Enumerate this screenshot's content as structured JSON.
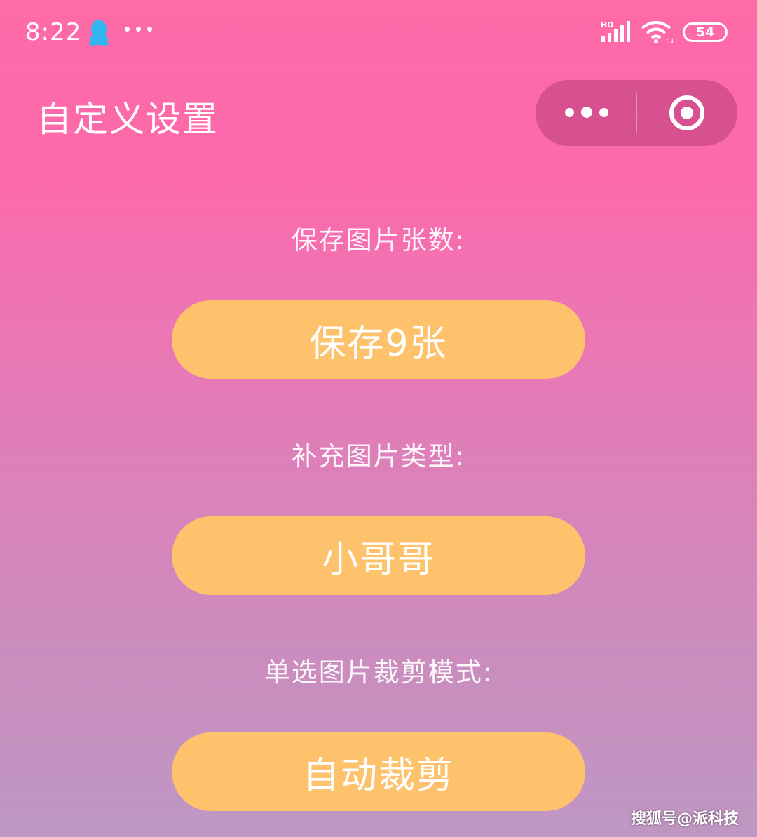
{
  "status_bar": {
    "time": "8:22",
    "battery": "54",
    "qq_icon": "qq-penguin-icon",
    "signal_label": "HD"
  },
  "nav": {
    "title": "自定义设置",
    "more_icon": "more-dots-icon",
    "close_icon": "target-close-icon",
    "capsule_color": "#b8407f"
  },
  "settings": [
    {
      "label": "保存图片张数:",
      "value": "保存9张"
    },
    {
      "label": "补充图片类型:",
      "value": "小哥哥"
    },
    {
      "label": "单选图片裁剪模式:",
      "value": "自动裁剪"
    }
  ],
  "colors": {
    "gradient_top": "#ff6aa8",
    "gradient_bottom": "#bf97c3",
    "button": "#fec26c",
    "text": "#ffffff"
  },
  "watermark": "搜狐号@派科技"
}
